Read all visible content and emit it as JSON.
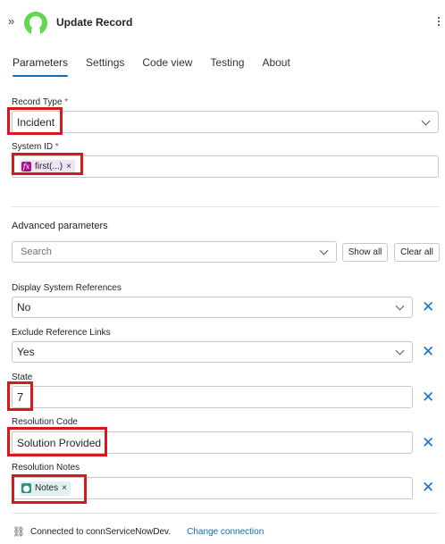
{
  "header": {
    "title": "Update Record",
    "expand_glyph": "»",
    "logo_icon": "servicenow-logo-icon",
    "brand_color": "#62d84e"
  },
  "tabs": [
    {
      "label": "Parameters",
      "active": true
    },
    {
      "label": "Settings",
      "active": false
    },
    {
      "label": "Code view",
      "active": false
    },
    {
      "label": "Testing",
      "active": false
    },
    {
      "label": "About",
      "active": false
    }
  ],
  "fields": {
    "record_type": {
      "label": "Record Type",
      "required_mark": "*",
      "value": "Incident"
    },
    "system_id": {
      "label": "System ID",
      "required_mark": "*",
      "token": "first(...)",
      "token_icon": "fx-icon"
    },
    "advanced": {
      "label": "Advanced parameters",
      "search_placeholder": "Search",
      "show_all": "Show all",
      "clear_all": "Clear all"
    },
    "display_system_references": {
      "label": "Display System References",
      "value": "No"
    },
    "exclude_reference_links": {
      "label": "Exclude Reference Links",
      "value": "Yes"
    },
    "state": {
      "label": "State",
      "value": "7"
    },
    "resolution_code": {
      "label": "Resolution Code",
      "value": "Solution Provided"
    },
    "resolution_notes": {
      "label": "Resolution Notes",
      "token": "Notes",
      "token_icon": "servicenow-token-icon"
    }
  },
  "footer": {
    "connection_text": "Connected to connServiceNowDev.",
    "change_link": "Change connection"
  },
  "colors": {
    "accent": "#0f6cbd",
    "highlight_box": "#d7191c",
    "fx_token": "#a6138d",
    "notes_token": "#2f8f83"
  }
}
